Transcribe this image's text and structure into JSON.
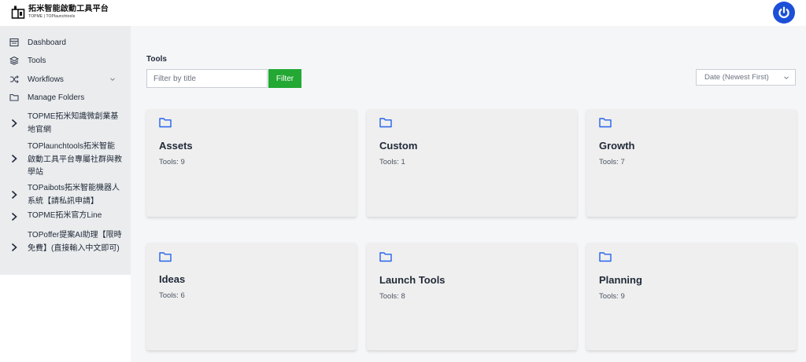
{
  "brand": {
    "name": "拓米智能啟動工具平台",
    "subtitle": "TOPME | TOPlaunchtools",
    "logo_icon": "gift-box-icon"
  },
  "header": {
    "power_icon": "power-icon",
    "accent_color": "#1c4fd8"
  },
  "sidebar": {
    "items": [
      {
        "label": "Dashboard",
        "icon": "dashboard-icon"
      },
      {
        "label": "Tools",
        "icon": "layers-icon"
      },
      {
        "label": "Workflows",
        "icon": "shuffle-icon",
        "has_dropdown": true
      },
      {
        "label": "Manage Folders",
        "icon": "folder-icon"
      }
    ],
    "external_links": [
      {
        "label": "TOPME拓米知識微創業基地官網"
      },
      {
        "label": "TOPlaunchtools拓米智能啟動工具平台專屬社群與教學站"
      },
      {
        "label": "TOPaibots拓米智能機器人系統【請私訊申請】"
      },
      {
        "label": "TOPME拓米官方Line"
      },
      {
        "label": "TOPoffer提案AI助理【限時免費】(直接輸入中文即可)"
      }
    ]
  },
  "main": {
    "section_title": "Tools",
    "filter_placeholder": "Filter by title",
    "filter_button": "Filter",
    "filter_button_color": "#22a833",
    "sort_value": "Date (Newest First)",
    "folders": [
      {
        "title": "Assets",
        "count": "Tools: 9"
      },
      {
        "title": "Custom",
        "count": "Tools: 1"
      },
      {
        "title": "Growth",
        "count": "Tools: 7"
      },
      {
        "title": "Ideas",
        "count": "Tools: 6"
      },
      {
        "title": "Launch Tools",
        "count": "Tools: 8"
      },
      {
        "title": "Planning",
        "count": "Tools: 9"
      }
    ]
  }
}
